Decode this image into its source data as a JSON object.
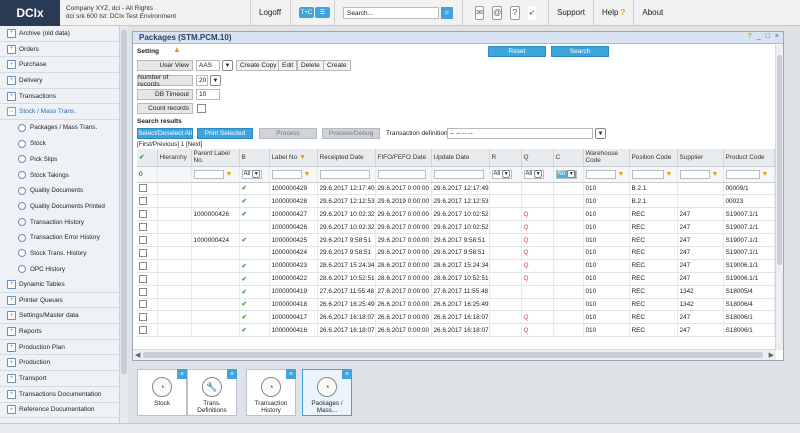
{
  "topbar": {
    "logo": "DCIx",
    "company_line1": "Company XYZ, dci - All Rights",
    "company_line2": "dci srk 600 tst: DCIx Test Environment",
    "logoff": "Logoff",
    "toggle_left": "T+C",
    "toggle_right": "",
    "search_placeholder": "Search...",
    "support": "Support",
    "help": "Help",
    "help_mark": "?",
    "about": "About"
  },
  "sidebar": {
    "items": [
      {
        "label": "Archive (old data)"
      },
      {
        "label": "Orders"
      },
      {
        "label": "Purchase"
      },
      {
        "label": "Delivery"
      },
      {
        "label": "Transactions"
      },
      {
        "label": "Stock / Mass Trans."
      }
    ],
    "sub_items": [
      {
        "label": "Packages / Mass Trans."
      },
      {
        "label": "Stock"
      },
      {
        "label": "Pick Slips"
      },
      {
        "label": "Stock Takings"
      },
      {
        "label": "Quality Documents"
      },
      {
        "label": "Quality Documents Printed"
      },
      {
        "label": "Transaction History"
      },
      {
        "label": "Transaction Error History"
      },
      {
        "label": "Stock Trans. History"
      },
      {
        "label": "OPC History"
      }
    ],
    "items_after": [
      {
        "label": "Dynamic Tables"
      },
      {
        "label": "Printer Queues"
      },
      {
        "label": "Settings/Master data"
      },
      {
        "label": "Reports"
      },
      {
        "label": "Production Plan"
      },
      {
        "label": "Production"
      },
      {
        "label": "Transport"
      },
      {
        "label": "Transactions Documentation"
      },
      {
        "label": "Reference Documentation"
      }
    ]
  },
  "window": {
    "title": "Packages (STM.PCM.10)",
    "controls": {
      "help": "?",
      "minimize": "_",
      "maximize": "□",
      "close": "×"
    },
    "setting_label": "Setting",
    "reset": "Reset",
    "search": "Search",
    "user_view_label": "User View",
    "user_view_value": "AAS",
    "copy_btn": "Create Copy",
    "edit_btn": "Edit",
    "delete_btn": "Delete",
    "create_btn": "Create",
    "num_records_label": "Number of records",
    "num_records_value": "20",
    "db_timeout_label": "DB Timeout",
    "db_timeout_value": "10",
    "count_records_label": "Count records",
    "search_results_label": "Search results",
    "select_deselect": "Select/Deselect All",
    "print_selected": "Print Selected",
    "process": "Process",
    "process_debug": "Process/Debug",
    "trans_def_label": "Transaction definition",
    "trans_def_value": "-- -- -- --",
    "paging": "[First/Previous] 1 [Next]"
  },
  "table": {
    "headers": [
      "",
      "Hierarchy",
      "Parent Label No.",
      "B",
      "Label No",
      "Receipted Date",
      "FIFO/FEFO Date",
      "Update Date",
      "R",
      "Q",
      "C",
      "Warehouse Code",
      "Position Code",
      "Supplier",
      "Product Code"
    ],
    "sort_mark": "▼",
    "filter_row": {
      "count": "0",
      "b": "All",
      "r": "All",
      "q": "All",
      "c": "No"
    },
    "rows": [
      {
        "parent": "",
        "b": "✔",
        "label": "1000000429",
        "receipted": "29.6.2017 12:17:40",
        "fifo": "29.6.2017 0:00:00",
        "update": "29.6.2017 12:17:49",
        "r": "",
        "q": "",
        "c": "",
        "wh": "010",
        "pos": "B.2.1",
        "supplier": "",
        "product": "00009/1"
      },
      {
        "parent": "",
        "b": "✔",
        "label": "1000000428",
        "receipted": "29.6.2017 12:12:53",
        "fifo": "29.6.2019 0:00:00",
        "update": "29.6.2017 12:12:53",
        "r": "",
        "q": "",
        "c": "",
        "wh": "010",
        "pos": "B.2.1",
        "supplier": "",
        "product": "00023"
      },
      {
        "parent": "1000000426",
        "b": "✔",
        "label": "1000000427",
        "receipted": "29.6.2017 10:02:32",
        "fifo": "29.6.2017 0:00:00",
        "update": "29.6.2017 10:02:52",
        "r": "",
        "q": "Q",
        "c": "",
        "wh": "010",
        "pos": "REC",
        "supplier": "247",
        "product": "S19007.1/1"
      },
      {
        "parent": "",
        "b": "",
        "label": "1000000426",
        "receipted": "29.6.2017 10:02:32",
        "fifo": "29.6.2017 0:00:00",
        "update": "29.6.2017 10:02:52",
        "r": "",
        "q": "Q",
        "c": "",
        "wh": "010",
        "pos": "REC",
        "supplier": "247",
        "product": "S19007.1/1"
      },
      {
        "parent": "1000000424",
        "b": "✔",
        "label": "1000000425",
        "receipted": "29.6.2017 9:58:51",
        "fifo": "29.6.2017 0:00:00",
        "update": "29.6.2017 9:58:51",
        "r": "",
        "q": "Q",
        "c": "",
        "wh": "010",
        "pos": "REC",
        "supplier": "247",
        "product": "S19007.1/1"
      },
      {
        "parent": "",
        "b": "",
        "label": "1000000424",
        "receipted": "29.6.2017 9:58:51",
        "fifo": "29.6.2017 0:00:00",
        "update": "29.6.2017 9:58:51",
        "r": "",
        "q": "Q",
        "c": "",
        "wh": "010",
        "pos": "REC",
        "supplier": "247",
        "product": "S19007.1/1"
      },
      {
        "parent": "",
        "b": "✔",
        "label": "1000000423",
        "receipted": "28.6.2017 15:24:34",
        "fifo": "28.6.2017 0:00:00",
        "update": "28.6.2017 15:24:34",
        "r": "",
        "q": "Q",
        "c": "",
        "wh": "010",
        "pos": "REC",
        "supplier": "247",
        "product": "S19006.1/1"
      },
      {
        "parent": "",
        "b": "✔",
        "label": "1000000422",
        "receipted": "28.6.2017 10:52:51",
        "fifo": "28.6.2017 0:00:00",
        "update": "28.6.2017 10:52:51",
        "r": "",
        "q": "Q",
        "c": "",
        "wh": "010",
        "pos": "REC",
        "supplier": "247",
        "product": "S19006.1/1"
      },
      {
        "parent": "",
        "b": "✔",
        "label": "1000000419",
        "receipted": "27.6.2017 11:55:48",
        "fifo": "27.6.2017 0:00:00",
        "update": "27.6.2017 11:55:48",
        "r": "",
        "q": "",
        "c": "",
        "wh": "010",
        "pos": "REC",
        "supplier": "1342",
        "product": "S18005/4"
      },
      {
        "parent": "",
        "b": "✔",
        "label": "1000000418",
        "receipted": "26.6.2017 16:25:49",
        "fifo": "26.6.2017 0:00:00",
        "update": "26.6.2017 16:25:49",
        "r": "",
        "q": "",
        "c": "",
        "wh": "010",
        "pos": "REC",
        "supplier": "1342",
        "product": "S18006/4"
      },
      {
        "parent": "",
        "b": "✔",
        "label": "1000000417",
        "receipted": "26.6.2017 16:18:07",
        "fifo": "26.6.2017 0:00:00",
        "update": "26.6.2017 16:18:07",
        "r": "",
        "q": "Q",
        "c": "",
        "wh": "010",
        "pos": "REC",
        "supplier": "247",
        "product": "S18006/1"
      },
      {
        "parent": "",
        "b": "✔",
        "label": "1000000416",
        "receipted": "26.6.2017 16:18:07",
        "fifo": "26.6.2017 0:00:00",
        "update": "26.6.2017 16:18:07",
        "r": "",
        "q": "Q",
        "c": "",
        "wh": "010",
        "pos": "REC",
        "supplier": "247",
        "product": "S18006/1"
      }
    ]
  },
  "favorites": [
    {
      "label": "Stock",
      "icon": "gauge-icon"
    },
    {
      "label": "Trans. Definitions",
      "icon": "wrench-icon"
    },
    {
      "label": "Transaction History",
      "icon": "gauge-icon"
    },
    {
      "label": "Packages / Mass...",
      "icon": "gauge-icon"
    }
  ],
  "colors": {
    "accent": "#3ea4dc",
    "warning": "#e69a1b",
    "ok": "#3aa63a",
    "error": "#d23b3b"
  }
}
